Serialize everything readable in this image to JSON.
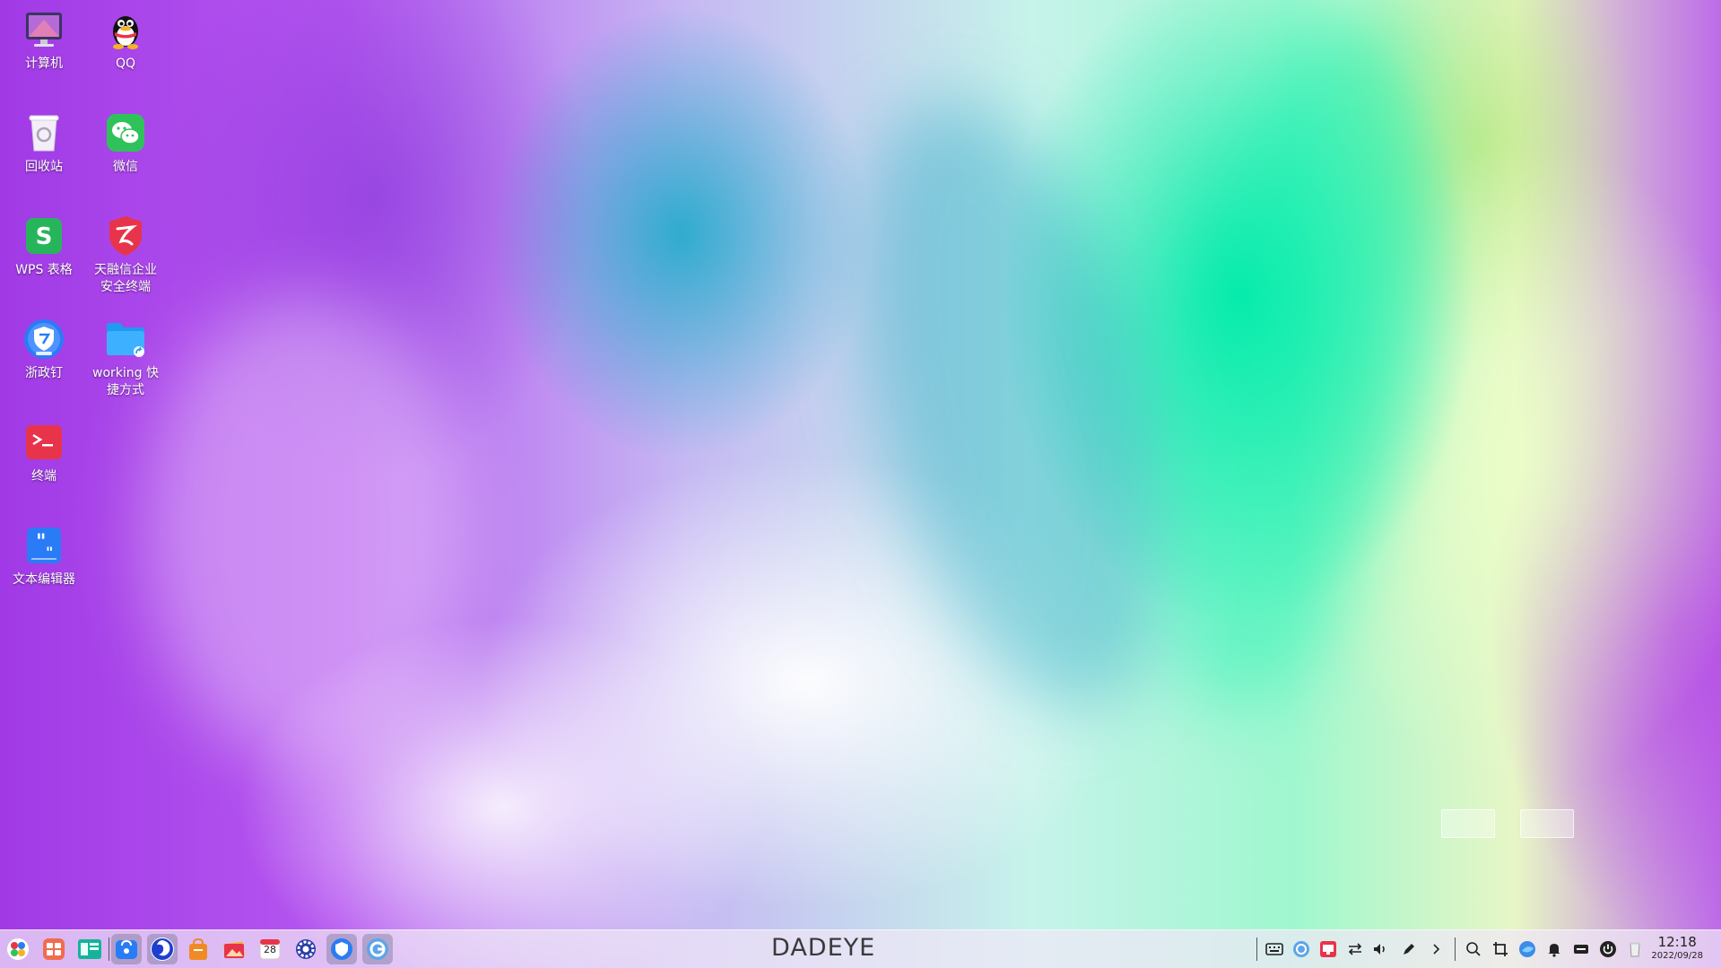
{
  "desktop_icons": [
    {
      "label": "计算机",
      "icon": "computer-icon"
    },
    {
      "label": "QQ",
      "icon": "qq-penguin-icon"
    },
    {
      "label": "回收站",
      "icon": "trash-icon"
    },
    {
      "label": "微信",
      "icon": "wechat-icon"
    },
    {
      "label": "WPS 表格",
      "icon": "wps-sheet-icon"
    },
    {
      "label": "天融信企业\n安全终端",
      "icon": "topsec-shield-icon"
    },
    {
      "label": "浙政钉",
      "icon": "zhezhengding-icon"
    },
    {
      "label": "working 快\n捷方式",
      "icon": "folder-shortcut-icon"
    },
    {
      "label": "终端",
      "icon": "terminal-icon"
    },
    {
      "label": "文本编辑器",
      "icon": "text-editor-icon"
    }
  ],
  "taskbar": {
    "center_text": "DADEYE",
    "calendar_day": "28",
    "clock_time": "12:18",
    "clock_date": "2022/09/28"
  },
  "colors": {
    "accent_red": "#e8344a",
    "accent_green": "#2fc25b",
    "accent_blue": "#2a7bf6"
  }
}
